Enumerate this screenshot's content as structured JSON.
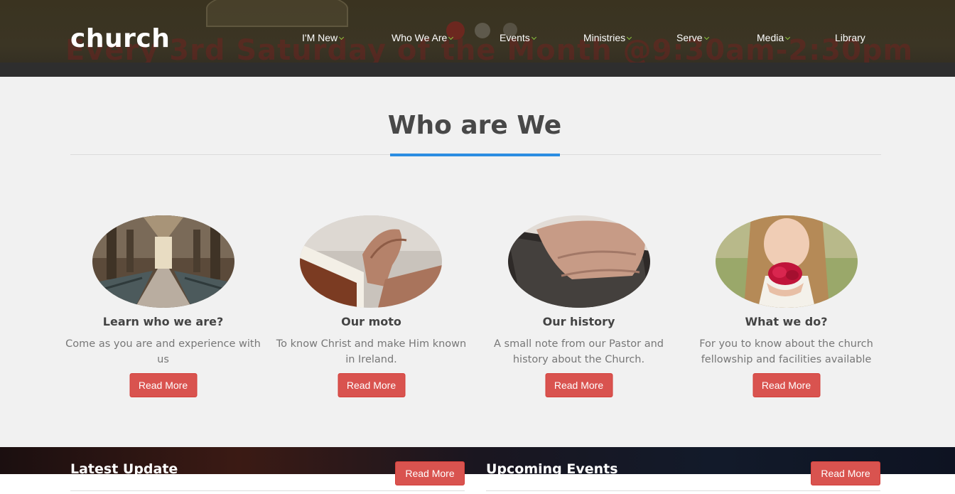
{
  "header": {
    "logo": "church",
    "banner_text": "Every 3rd Saturday of the Month @9:30am-2:30pm",
    "nav": [
      {
        "label": "I'M New",
        "dropdown": true
      },
      {
        "label": "Who We Are",
        "dropdown": true
      },
      {
        "label": "Events",
        "dropdown": true
      },
      {
        "label": "Ministries",
        "dropdown": true
      },
      {
        "label": "Serve",
        "dropdown": true
      },
      {
        "label": "Media",
        "dropdown": true
      },
      {
        "label": "Library",
        "dropdown": false
      }
    ],
    "chevron_icon": "chevron-down-icon",
    "chevron_color": "#8cc63f"
  },
  "section": {
    "title": "Who are We",
    "accent_color": "#2b8de2"
  },
  "cards": [
    {
      "title": "Learn who we are?",
      "text": "Come as you are and experience with us",
      "button": "Read More",
      "image": "church-interior"
    },
    {
      "title": "Our moto",
      "text": "To know Christ and make Him known in Ireland.",
      "button": "Read More",
      "image": "praying-hands-bible"
    },
    {
      "title": "Our history",
      "text": "A small note from our Pastor and history about the Church.",
      "button": "Read More",
      "image": "hands-on-bible"
    },
    {
      "title": "What we do?",
      "text": "For you to know about the church fellowship and facilities available",
      "button": "Read More",
      "image": "girl-with-flower"
    }
  ],
  "bottom": {
    "latest": {
      "title": "Latest Update",
      "button": "Read More"
    },
    "upcoming": {
      "title": "Upcoming Events",
      "button": "Read More"
    }
  },
  "colors": {
    "button_bg": "#d9534f",
    "page_bg": "#f1f1f1"
  }
}
